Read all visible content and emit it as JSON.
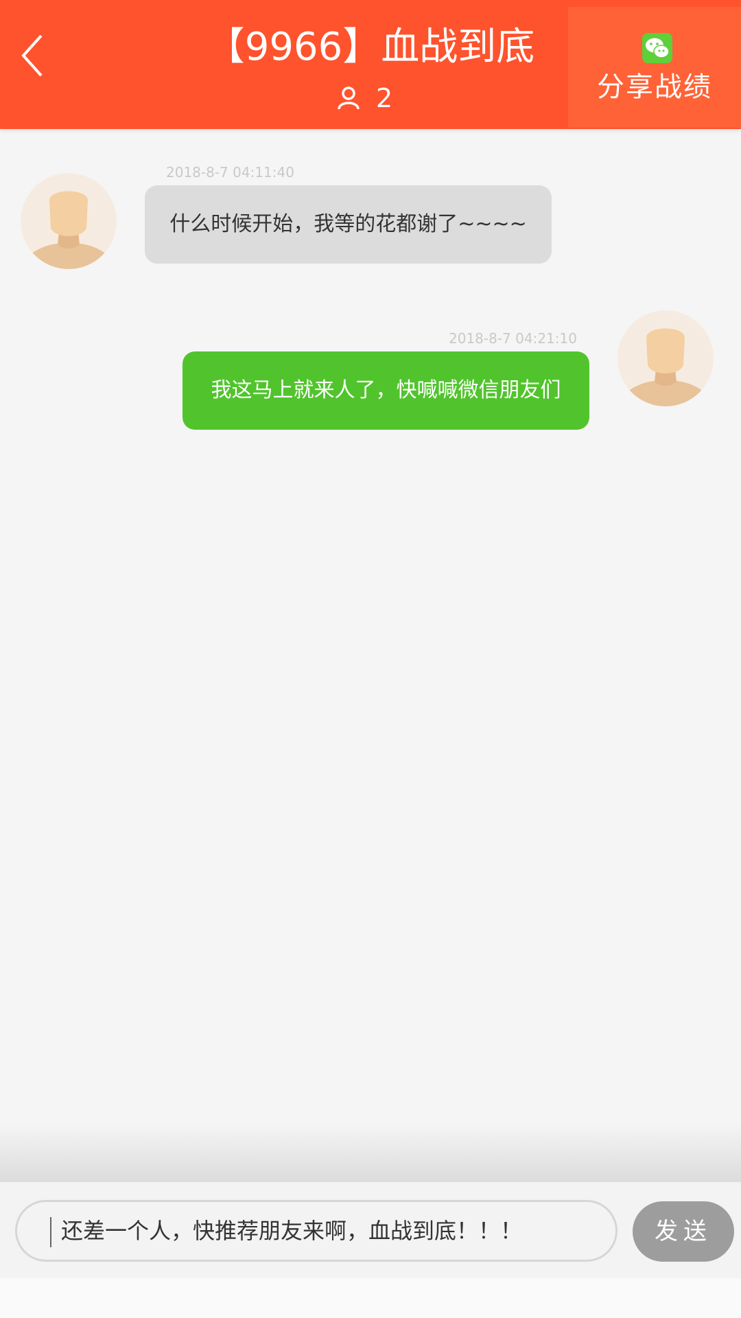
{
  "header": {
    "back_icon": "chevron-left-icon",
    "title": "【9966】血战到底",
    "member_icon": "user-icon",
    "member_count": "2",
    "share_icon": "wechat-icon",
    "share_label": "分享战绩",
    "colors": {
      "bar": "#fe532d",
      "share_bg": "#ff6236"
    }
  },
  "messages": [
    {
      "side": "incoming",
      "time": "2018-8-7 04:11:40",
      "text": "什么时候开始，我等的花都谢了~~~~",
      "avatar": "default-avatar-icon"
    },
    {
      "side": "outgoing",
      "time": "2018-8-7 04:21:10",
      "text": "我这马上就来人了，快喊喊微信朋友们",
      "avatar": "default-avatar-icon"
    }
  ],
  "composer": {
    "input_value": "还差一个人，快推荐朋友来啊，血战到底！！！",
    "send_label": "发送",
    "colors": {
      "send_bg": "#9d9d9d",
      "outgoing_bubble": "#51c42d",
      "incoming_bubble": "#dcdcdc"
    }
  }
}
